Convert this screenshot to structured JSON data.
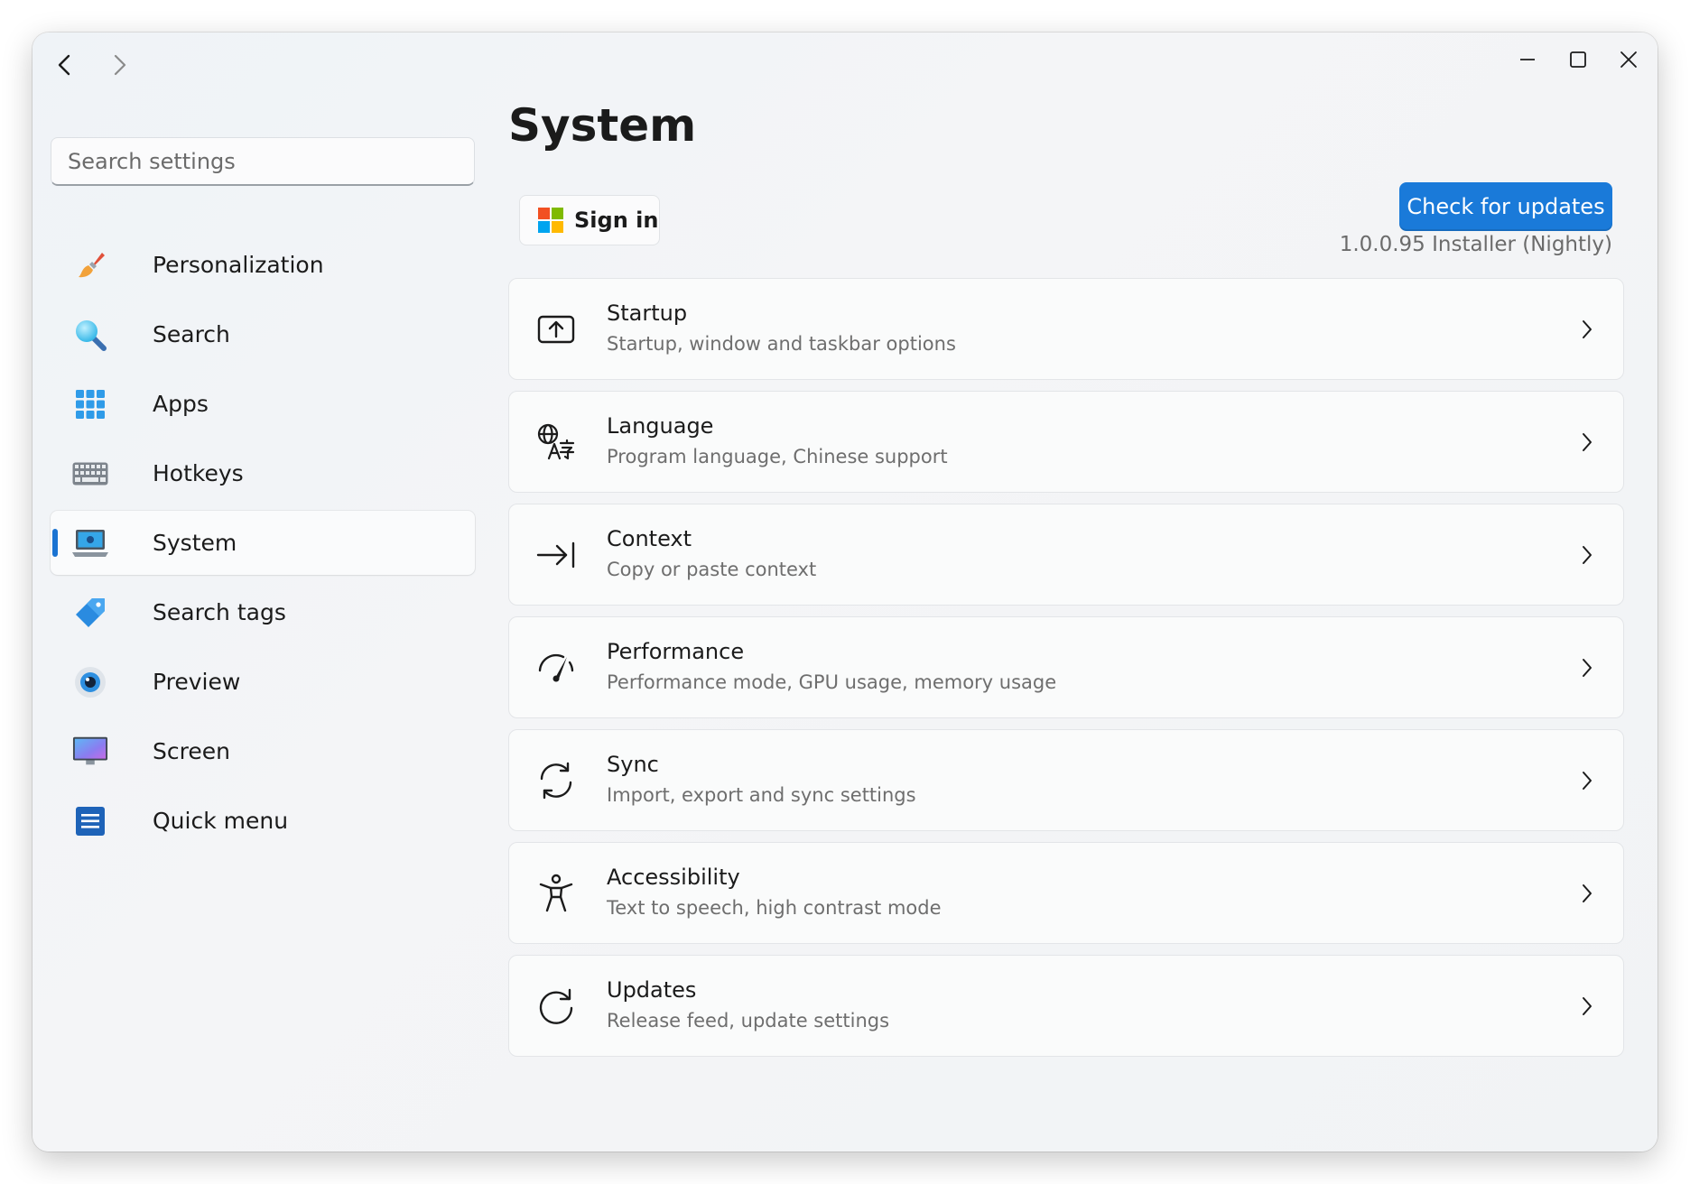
{
  "window": {
    "icons": {
      "back": "chevron-left-icon",
      "forward": "chevron-right-icon",
      "minimize": "minimize-icon",
      "maximize": "maximize-icon",
      "close": "close-icon"
    }
  },
  "sidebar": {
    "search": {
      "placeholder": "Search settings",
      "value": ""
    },
    "items": [
      {
        "label": "Personalization",
        "icon": "paintbrush-icon",
        "selected": false
      },
      {
        "label": "Search",
        "icon": "magnifier-icon",
        "selected": false
      },
      {
        "label": "Apps",
        "icon": "apps-grid-icon",
        "selected": false
      },
      {
        "label": "Hotkeys",
        "icon": "keyboard-icon",
        "selected": false
      },
      {
        "label": "System",
        "icon": "laptop-icon",
        "selected": true
      },
      {
        "label": "Search tags",
        "icon": "tag-icon",
        "selected": false
      },
      {
        "label": "Preview",
        "icon": "eye-icon",
        "selected": false
      },
      {
        "label": "Screen",
        "icon": "monitor-icon",
        "selected": false
      },
      {
        "label": "Quick menu",
        "icon": "menu-list-icon",
        "selected": false
      }
    ]
  },
  "main": {
    "title": "System",
    "signin_label": "Sign in",
    "update_button_label": "Check for updates",
    "version_text": "1.0.0.95 Installer (Nightly)",
    "cards": [
      {
        "title": "Startup",
        "subtitle": "Startup, window and taskbar options",
        "icon": "startup-icon"
      },
      {
        "title": "Language",
        "subtitle": "Program language, Chinese support",
        "icon": "language-icon"
      },
      {
        "title": "Context",
        "subtitle": "Copy or paste context",
        "icon": "arrow-to-line-icon"
      },
      {
        "title": "Performance",
        "subtitle": "Performance mode, GPU usage, memory usage",
        "icon": "gauge-icon"
      },
      {
        "title": "Sync",
        "subtitle": "Import, export and sync settings",
        "icon": "sync-icon"
      },
      {
        "title": "Accessibility",
        "subtitle": "Text to speech, high contrast mode",
        "icon": "accessibility-icon"
      },
      {
        "title": "Updates",
        "subtitle": "Release feed, update settings",
        "icon": "refresh-icon"
      }
    ]
  },
  "colors": {
    "accent": "#1a7ad9",
    "selection_indicator": "#1a73d2",
    "text_primary": "#1b1b1b",
    "text_secondary": "#6e6e6e"
  }
}
